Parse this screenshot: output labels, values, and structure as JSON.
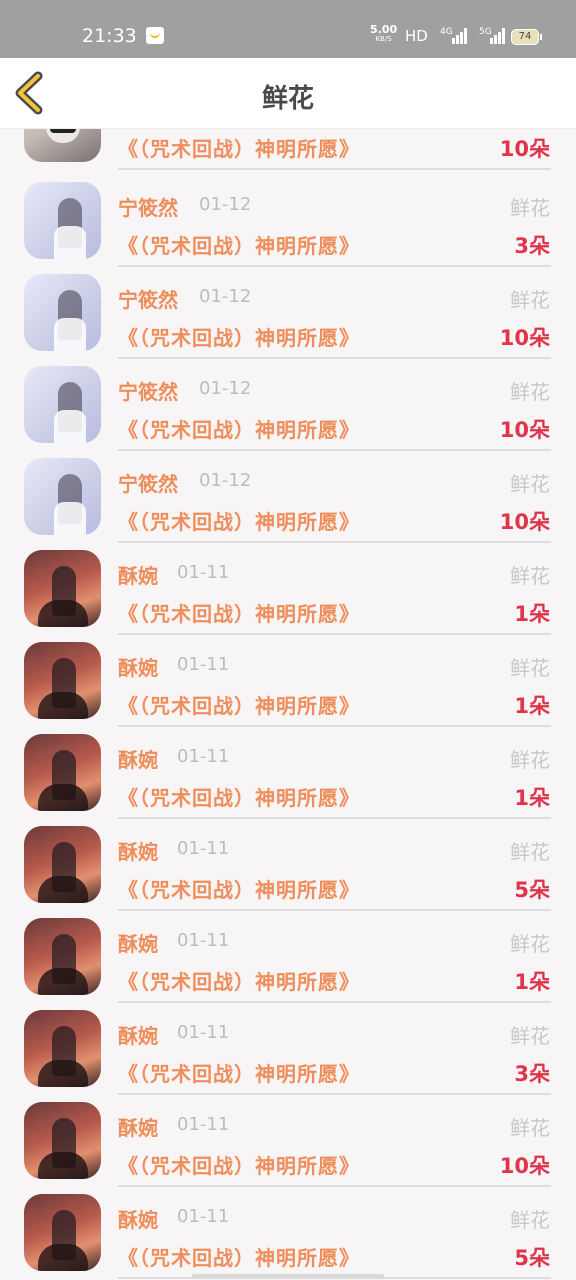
{
  "status_bar": {
    "time": "21:33",
    "speed_value": "5.00",
    "speed_unit": "KB/S",
    "hd": "HD",
    "net1": "4G",
    "net2": "5G",
    "battery": "74"
  },
  "header": {
    "title": "鲜花"
  },
  "colors": {
    "name": "#ef8e5b",
    "count": "#e0344a",
    "kind": "#c8c8c8",
    "date": "#bdbdbd"
  },
  "records": [
    {
      "name": "",
      "date": "",
      "kind": "",
      "book": "《（咒术回战）神明所愿》",
      "count": "10朵",
      "avatar": "masked-girl"
    },
    {
      "name": "宁筱然",
      "date": "01-12",
      "kind": "鲜花",
      "book": "《（咒术回战）神明所愿》",
      "count": "3朵",
      "avatar": "girl-white-dress"
    },
    {
      "name": "宁筱然",
      "date": "01-12",
      "kind": "鲜花",
      "book": "《（咒术回战）神明所愿》",
      "count": "10朵",
      "avatar": "girl-white-dress"
    },
    {
      "name": "宁筱然",
      "date": "01-12",
      "kind": "鲜花",
      "book": "《（咒术回战）神明所愿》",
      "count": "10朵",
      "avatar": "girl-white-dress"
    },
    {
      "name": "宁筱然",
      "date": "01-12",
      "kind": "鲜花",
      "book": "《（咒术回战）神明所愿》",
      "count": "10朵",
      "avatar": "girl-white-dress"
    },
    {
      "name": "酥婉",
      "date": "01-11",
      "kind": "鲜花",
      "book": "《（咒术回战）神明所愿》",
      "count": "1朵",
      "avatar": "anime-sunset"
    },
    {
      "name": "酥婉",
      "date": "01-11",
      "kind": "鲜花",
      "book": "《（咒术回战）神明所愿》",
      "count": "1朵",
      "avatar": "anime-sunset"
    },
    {
      "name": "酥婉",
      "date": "01-11",
      "kind": "鲜花",
      "book": "《（咒术回战）神明所愿》",
      "count": "1朵",
      "avatar": "anime-sunset"
    },
    {
      "name": "酥婉",
      "date": "01-11",
      "kind": "鲜花",
      "book": "《（咒术回战）神明所愿》",
      "count": "5朵",
      "avatar": "anime-sunset"
    },
    {
      "name": "酥婉",
      "date": "01-11",
      "kind": "鲜花",
      "book": "《（咒术回战）神明所愿》",
      "count": "1朵",
      "avatar": "anime-sunset"
    },
    {
      "name": "酥婉",
      "date": "01-11",
      "kind": "鲜花",
      "book": "《（咒术回战）神明所愿》",
      "count": "3朵",
      "avatar": "anime-sunset"
    },
    {
      "name": "酥婉",
      "date": "01-11",
      "kind": "鲜花",
      "book": "《（咒术回战）神明所愿》",
      "count": "10朵",
      "avatar": "anime-sunset"
    },
    {
      "name": "酥婉",
      "date": "01-11",
      "kind": "鲜花",
      "book": "《（咒术回战）神明所愿》",
      "count": "5朵",
      "avatar": "anime-sunset"
    }
  ]
}
